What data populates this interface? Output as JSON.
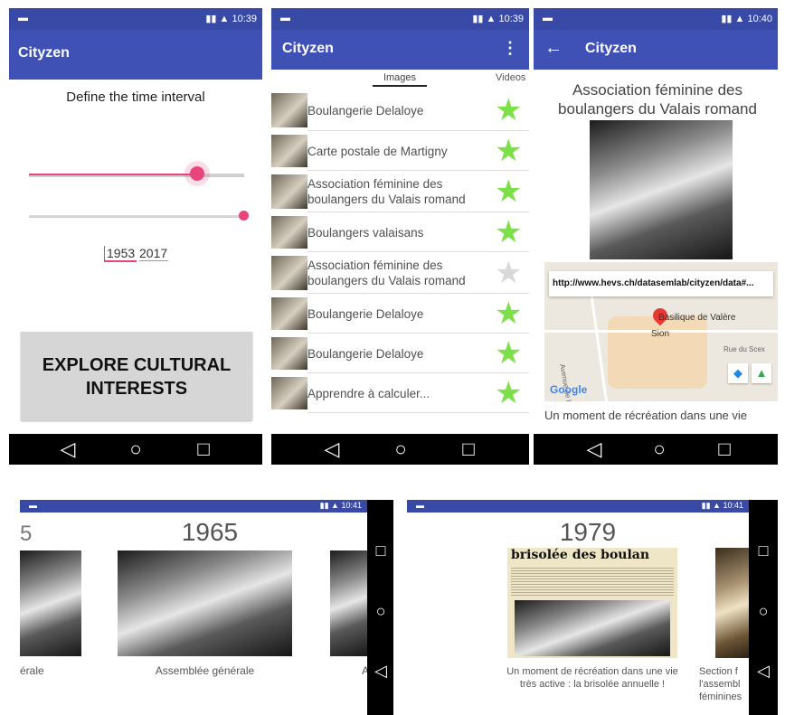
{
  "status": {
    "screen1_time": "10:39",
    "screen2_time": "10:39",
    "screen3_time": "10:40",
    "screen4_time": "10:41",
    "screen5_time": "10:41"
  },
  "app": {
    "title": "Cityzen"
  },
  "screen1": {
    "heading": "Define the time interval",
    "slider1_level": 0.78,
    "slider2_level": 1.0,
    "year_from": "1953",
    "year_to": "2017",
    "explore_line1": "EXPLORE CULTURAL",
    "explore_line2": "INTERESTS"
  },
  "screen2": {
    "tab_images": "Images",
    "tab_videos": "Videos",
    "menu_icon": "⋮",
    "items": [
      {
        "label": "Boulangerie Delaloye",
        "favorite": true
      },
      {
        "label": "Carte postale de Martigny",
        "favorite": true
      },
      {
        "label": "Association féminine des boulangers du Valais romand",
        "favorite": true
      },
      {
        "label": "Boulangers valaisans",
        "favorite": true
      },
      {
        "label": "Association féminine des boulangers du Valais romand",
        "favorite": false
      },
      {
        "label": "Boulangerie Delaloye",
        "favorite": true
      },
      {
        "label": "Boulangerie Delaloye",
        "favorite": true
      },
      {
        "label": "Apprendre à calculer...",
        "favorite": true
      }
    ]
  },
  "screen3": {
    "title": "Association féminine des boulangers du Valais romand",
    "map_url": "http://www.hevs.ch/datasemlab/cityzen/data#...",
    "map_place1": "Basilique de Valère",
    "map_place2": "Sion",
    "map_street1": "Rue du Scex",
    "map_street2": "Avenue de la Gare",
    "map_logo": "Google",
    "caption": "Un moment de récréation dans une vie"
  },
  "screen4": {
    "year": "1965",
    "left_caption": "érale",
    "center_caption": "Assemblée générale",
    "right_caption": "A"
  },
  "screen5": {
    "year": "1979",
    "headline": "brisolée des boulan",
    "center_caption_line1": "Un moment de récréation dans une vie",
    "center_caption_line2": "très active : la brisolée annuelle !",
    "right_caption_line1": "Section f",
    "right_caption_line2": "l'assembl",
    "right_caption_line3": "féminines"
  },
  "colors": {
    "primary": "#3f51b5",
    "status": "#3849a6",
    "accent_pink": "#e8457b",
    "star_green": "#7de04a",
    "star_grey": "#d9d9d9"
  }
}
